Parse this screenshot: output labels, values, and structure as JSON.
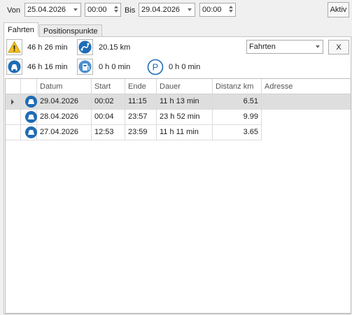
{
  "filter": {
    "from_label": "Von",
    "from_date": "25.04.2026",
    "from_time": "00:00",
    "to_label": "Bis",
    "to_date": "29.04.2026",
    "to_time": "00:00",
    "active_label": "Aktiv"
  },
  "tabs": [
    {
      "label": "Fahrten"
    },
    {
      "label": "Positionspunkte"
    }
  ],
  "summary": {
    "warning_time": "46 h 26 min",
    "distance": "20.15 km",
    "drive_time": "46 h 16 min",
    "idle_time": "0 h 0 min",
    "parking_time": "0 h 0 min"
  },
  "view_select": {
    "value": "Fahrten"
  },
  "clear_label": "X",
  "grid": {
    "columns": [
      "Datum",
      "Start",
      "Ende",
      "Dauer",
      "Distanz km",
      "Adresse"
    ],
    "rows": [
      {
        "datum": "29.04.2026",
        "start": "00:02",
        "ende": "11:15",
        "dauer": "11 h 13 min",
        "distanz": "6.51",
        "adresse": ""
      },
      {
        "datum": "28.04.2026",
        "start": "00:04",
        "ende": "23:57",
        "dauer": "23 h 52 min",
        "distanz": "9.99",
        "adresse": ""
      },
      {
        "datum": "27.04.2026",
        "start": "12:53",
        "ende": "23:59",
        "dauer": "11 h 11 min",
        "distanz": "3.65",
        "adresse": ""
      }
    ]
  },
  "colors": {
    "icon_blue": "#1f6cb5",
    "warning_yellow": "#f5c31c",
    "selected_row": "#dedede"
  },
  "icons": [
    "warning-icon",
    "route-icon",
    "car-icon",
    "idle-icon",
    "parking-icon",
    "row-pointer-icon"
  ]
}
